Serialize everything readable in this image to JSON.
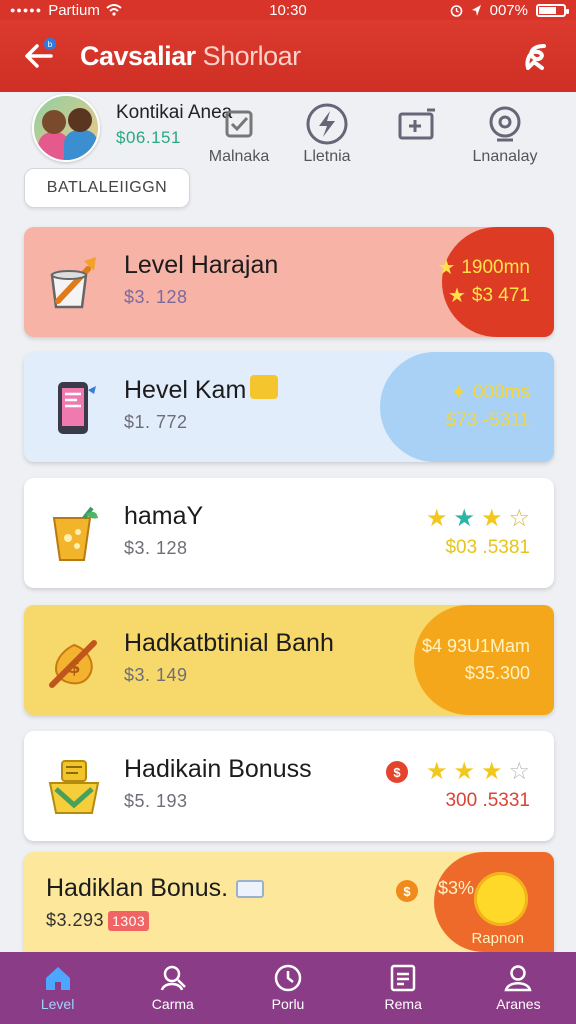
{
  "status_bar": {
    "carrier": "Partium",
    "time": "10:30",
    "battery_percent": "007%",
    "battery_level": 0.7
  },
  "app_bar": {
    "title_bold": "Cavsaliar",
    "title_thin": "Shorloar",
    "back_badge": "b"
  },
  "profile": {
    "name": "Kontikai Anea",
    "balance": "$06.151"
  },
  "quick_actions": [
    {
      "label": "Malnaka",
      "icon": "checklist-icon"
    },
    {
      "label": "Lletnia",
      "icon": "lightning-icon"
    },
    {
      "label": "",
      "icon": "ticket-icon"
    },
    {
      "label": "Lnanalay",
      "icon": "webcam-icon"
    }
  ],
  "filter_chip": "BATLALEIIGGN",
  "cards": [
    {
      "title": "Level Harajan",
      "subtitle": "$3. 128",
      "right_top": "1900mn",
      "right_bottom": "$3 471",
      "stars": 0
    },
    {
      "title": "Hevel Kam",
      "subtitle": "$1. 772",
      "right_top": "000ms",
      "right_bottom": "$73 -5311",
      "stars": 0
    },
    {
      "title": "hamaY",
      "subtitle": "$3. 128",
      "right_top": "",
      "right_bottom": "$03 .5381",
      "stars": 3
    },
    {
      "title": "Hadkatbtinial Banh",
      "subtitle": "$3. 149",
      "right_top": "$4 93U1Mam",
      "right_bottom": "$35.300",
      "stars": 0
    },
    {
      "title": "Hadikain Bonuss",
      "subtitle": "$5. 193",
      "right_top": "",
      "right_bottom": "300 .5331",
      "stars": 3
    },
    {
      "title": "Hadiklan Bonus.",
      "subtitle": "$3.293",
      "badge": "1303",
      "right_top": "$3%",
      "right_bottom": "Rapnon",
      "stars": 0
    }
  ],
  "bottom_nav": [
    {
      "label": "Level",
      "icon": "home-icon",
      "active": true
    },
    {
      "label": "Carma",
      "icon": "user-search-icon",
      "active": false
    },
    {
      "label": "Porlu",
      "icon": "clock-icon",
      "active": false
    },
    {
      "label": "Rema",
      "icon": "document-icon",
      "active": false
    },
    {
      "label": "Aranes",
      "icon": "profile-icon",
      "active": false
    }
  ],
  "colors": {
    "app_bar": "#d8342a",
    "bottom_nav": "#8a3d86",
    "balance_green": "#2aa882"
  }
}
